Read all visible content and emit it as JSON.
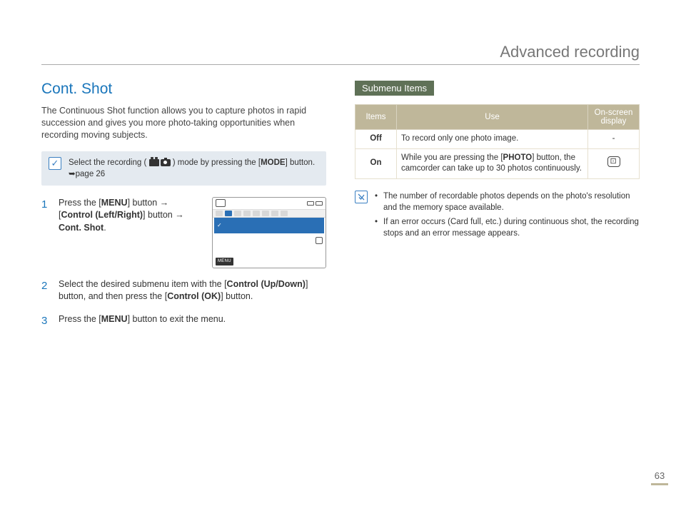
{
  "header": {
    "title": "Advanced recording"
  },
  "left": {
    "title": "Cont. Shot",
    "intro": "The Continuous Shot function allows you to capture photos in rapid succession and gives you more photo-taking opportunities when recording moving subjects.",
    "callout": {
      "pre": "Select the recording (",
      "post": ") mode by pressing the [",
      "mode": "MODE",
      "tail": "] button. ",
      "ref": "➥page 26"
    },
    "steps": [
      {
        "l1a": "Press the [",
        "l1b": "MENU",
        "l1c": "] button → ",
        "l2a": "[",
        "l2b": "Control (Left/Right)",
        "l2c": "] button → ",
        "l3": "Cont. Shot",
        "l3end": "."
      },
      {
        "t1": "Select the desired submenu item with the [",
        "b1": "Control (Up/Down)",
        "t2": "] button, and then press the [",
        "b2": "Control (OK)",
        "t3": "] button."
      },
      {
        "t1": "Press the [",
        "b1": "MENU",
        "t2": "] button to exit the menu."
      }
    ],
    "lcd": {
      "menu_label": "MENU"
    }
  },
  "right": {
    "subhead": "Submenu Items",
    "table": {
      "headers": {
        "items": "Items",
        "use": "Use",
        "osd": "On-screen display"
      },
      "rows": [
        {
          "item": "Off",
          "use_plain": "To record only one photo image.",
          "osd": "-"
        },
        {
          "item": "On",
          "use_pre": "While you are pressing the [",
          "use_bold": "PHOTO",
          "use_post": "] button, the camcorder can take up to 30 photos continuously.",
          "osd_icon": true
        }
      ]
    },
    "notes": [
      "The number of recordable photos depends on the photo's resolution and the memory space available.",
      "If an error occurs (Card full, etc.) during continuous shot, the recording stops and an error message appears."
    ]
  },
  "page": {
    "num": "63"
  }
}
